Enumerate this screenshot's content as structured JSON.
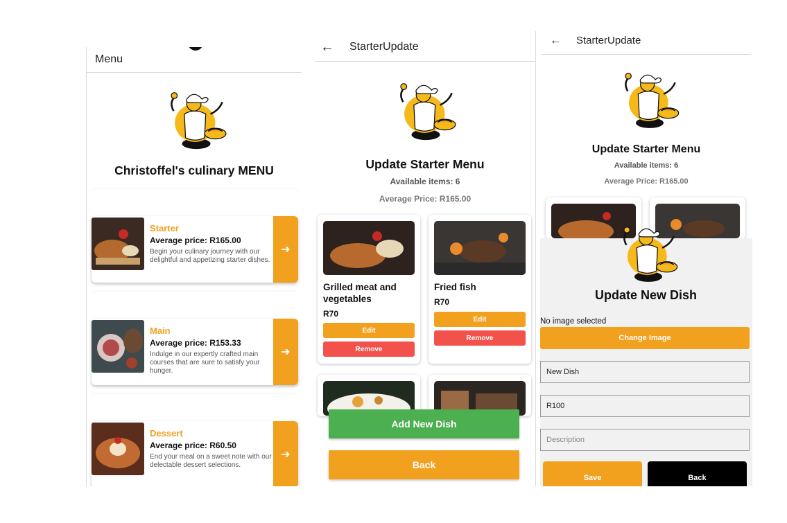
{
  "menu_screen": {
    "title": "Menu",
    "heading": "Christoffel's culinary MENU",
    "categories": [
      {
        "name": "Starter",
        "price": "Average price: R165.00",
        "desc": "Begin your culinary journey with our delightful and appetizing starter dishes."
      },
      {
        "name": "Main",
        "price": "Average price: R153.33",
        "desc": "Indulge in our expertly crafted main courses that are sure to satisfy your hunger."
      },
      {
        "name": "Dessert",
        "price": "Average price: R60.50",
        "desc": "End your meal on a sweet note with our delectable dessert selections."
      }
    ],
    "go_glyph": "➔"
  },
  "update_screen": {
    "title": "StarterUpdate",
    "heading": "Update Starter Menu",
    "available": "Available items: 6",
    "average": "Average Price: R165.00",
    "dishes": [
      {
        "name": "Grilled meat and vegetables",
        "price": "R70",
        "edit": "Edit",
        "remove": "Remove"
      },
      {
        "name": "Fried fish",
        "price": "R70",
        "edit": "Edit",
        "remove": "Remove"
      }
    ],
    "add_button": "Add New Dish",
    "back_button": "Back"
  },
  "dialog_screen": {
    "title": "StarterUpdate",
    "heading": "Update Starter Menu",
    "available": "Available items: 6",
    "average": "Average Price: R165.00",
    "sheet_title": "Update New Dish",
    "no_image": "No image selected",
    "change_image": "Change Image",
    "name_value": "New Dish",
    "price_value": "R100",
    "description_placeholder": "Description",
    "save_button": "Save",
    "back_button": "Back"
  },
  "colors": {
    "accent": "#f2a11f",
    "green": "#4caf50",
    "danger": "#f2524b"
  },
  "icons": {
    "back": "back-arrow-icon",
    "go": "arrow-right-icon",
    "mascot": "chef-mascot"
  }
}
